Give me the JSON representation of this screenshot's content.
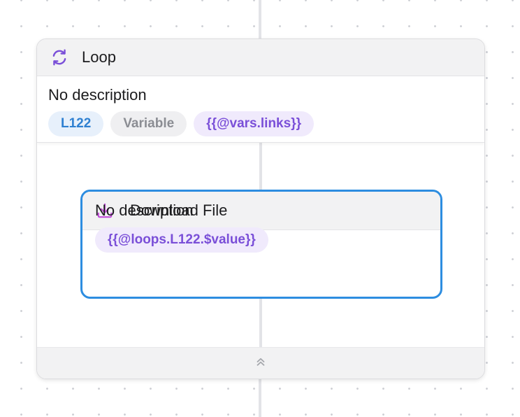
{
  "loop_node": {
    "title": "Loop",
    "icon": "refresh-icon",
    "description": "No description",
    "tags": {
      "id": "L122",
      "type": "Variable",
      "source": "{{@vars.links}}"
    }
  },
  "download_node": {
    "title": "Download File",
    "icon": "download-icon",
    "description": "No description",
    "tags": {
      "value": "{{@loops.L122.$value}}"
    }
  },
  "collapse": {
    "icon": "chevrons-up-icon"
  },
  "colors": {
    "loop_icon": "#7a4fd8",
    "download_icon": "#c04bd8",
    "selection_border": "#2d8de0",
    "id_tag_text": "#2f80d1",
    "variable_tag_text": "#7a4fd8"
  }
}
